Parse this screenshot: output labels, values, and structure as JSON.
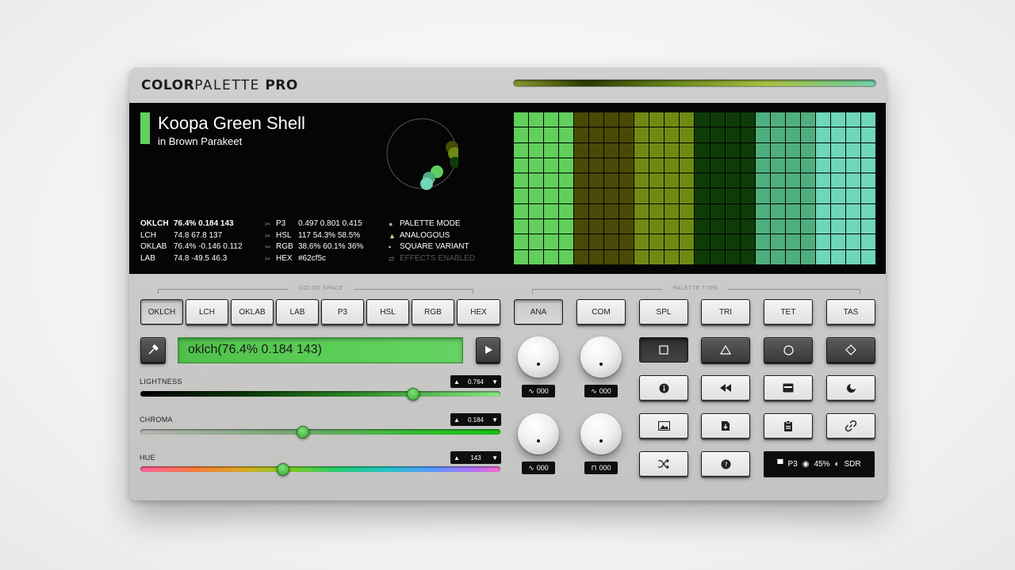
{
  "brand": {
    "part1": "COLOR",
    "part2": "PALETTE",
    "part3": " PRO"
  },
  "color": {
    "name": "Koopa Green Shell",
    "sub": "in Brown Parakeet",
    "hex_color": "#62cf5c",
    "input_value": "oklch(76.4% 0.184 143)"
  },
  "values_left": [
    {
      "k": "OKLCH",
      "v": "76.4% 0.184 143"
    },
    {
      "k": "LCH",
      "v": "74.8 67.8 137"
    },
    {
      "k": "OKLAB",
      "v": "76.4% -0.146 0.112"
    },
    {
      "k": "LAB",
      "v": "74.8 -49.5 46.3"
    }
  ],
  "values_mid": [
    {
      "k": "P3",
      "v": "0.497 0.801 0.415"
    },
    {
      "k": "HSL",
      "v": "117 54.3% 58.5%"
    },
    {
      "k": "RGB",
      "v": "38.6% 60.1% 36%"
    },
    {
      "k": "HEX",
      "v": "#62cf5c"
    }
  ],
  "modes": [
    {
      "label": "PALETTE MODE",
      "icon": "palette-icon"
    },
    {
      "label": "ANALOGOUS",
      "icon": "analogous-icon"
    },
    {
      "label": "SQUARE VARIANT",
      "icon": "square-variant-icon"
    },
    {
      "label": "EFFECTS ENABLED",
      "icon": "effects-icon"
    }
  ],
  "palette_columns": [
    "#62cf5c",
    "#62cf5c",
    "#62cf5c",
    "#62cf5c",
    "#4a4a06",
    "#4a4a06",
    "#4a4a06",
    "#4a4a06",
    "#6f8a12",
    "#6f8a12",
    "#6f8a12",
    "#6f8a12",
    "#0e3c08",
    "#0e3c08",
    "#0e3c08",
    "#0e3c08",
    "#4fae7e",
    "#4fae7e",
    "#4fae7e",
    "#4fae7e",
    "#6fd6b8",
    "#6fd6b8",
    "#6fd6b8",
    "#6fd6b8"
  ],
  "sections": {
    "color_space": "COLOR SPACE",
    "palette_type": "PALETTE TYPE"
  },
  "color_space_buttons": [
    "OKLCH",
    "LCH",
    "OKLAB",
    "LAB",
    "P3",
    "HSL",
    "RGB",
    "HEX"
  ],
  "palette_type_buttons": [
    "ANA",
    "COM",
    "SPL",
    "TRI",
    "TET",
    "TAS"
  ],
  "sliders": {
    "lightness": {
      "label": "LIGHTNESS",
      "value": "0.764",
      "fraction": 0.757
    },
    "chroma": {
      "label": "CHROMA",
      "value": "0.184",
      "fraction": 0.451
    },
    "hue": {
      "label": "HUE",
      "value": "143",
      "fraction": 0.397
    }
  },
  "lfos": [
    "000",
    "000",
    "000",
    "000"
  ],
  "status": {
    "space": "P3",
    "opacity": "45%",
    "range": "SDR"
  },
  "colors": {
    "accent": "#62cf5c",
    "screen": "#050505",
    "body": "#c8c8c6"
  }
}
